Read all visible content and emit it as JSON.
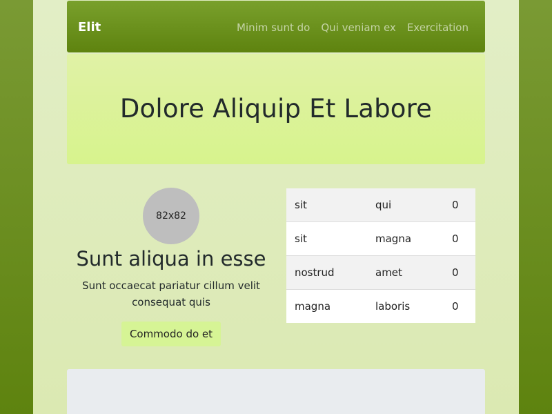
{
  "navbar": {
    "brand": "Elit",
    "links": [
      "Minim sunt do",
      "Qui veniam ex",
      "Exercitation"
    ]
  },
  "hero": {
    "title": "Dolore Aliquip Et Labore"
  },
  "profile": {
    "avatar_text": "82x82",
    "title": "Sunt aliqua in esse",
    "description": "Sunt occaecat pariatur cillum velit consequat quis",
    "button_label": "Commodo do et"
  },
  "table": {
    "rows": [
      [
        "sit",
        "qui",
        "0"
      ],
      [
        "sit",
        "magna",
        "0"
      ],
      [
        "nostrud",
        "amet",
        "0"
      ],
      [
        "magna",
        "laboris",
        "0"
      ]
    ]
  },
  "colors": {
    "navbar": "#5e830f",
    "hero": "#d7f38d",
    "button": "#d6f495",
    "background": "#dbe9b2"
  }
}
